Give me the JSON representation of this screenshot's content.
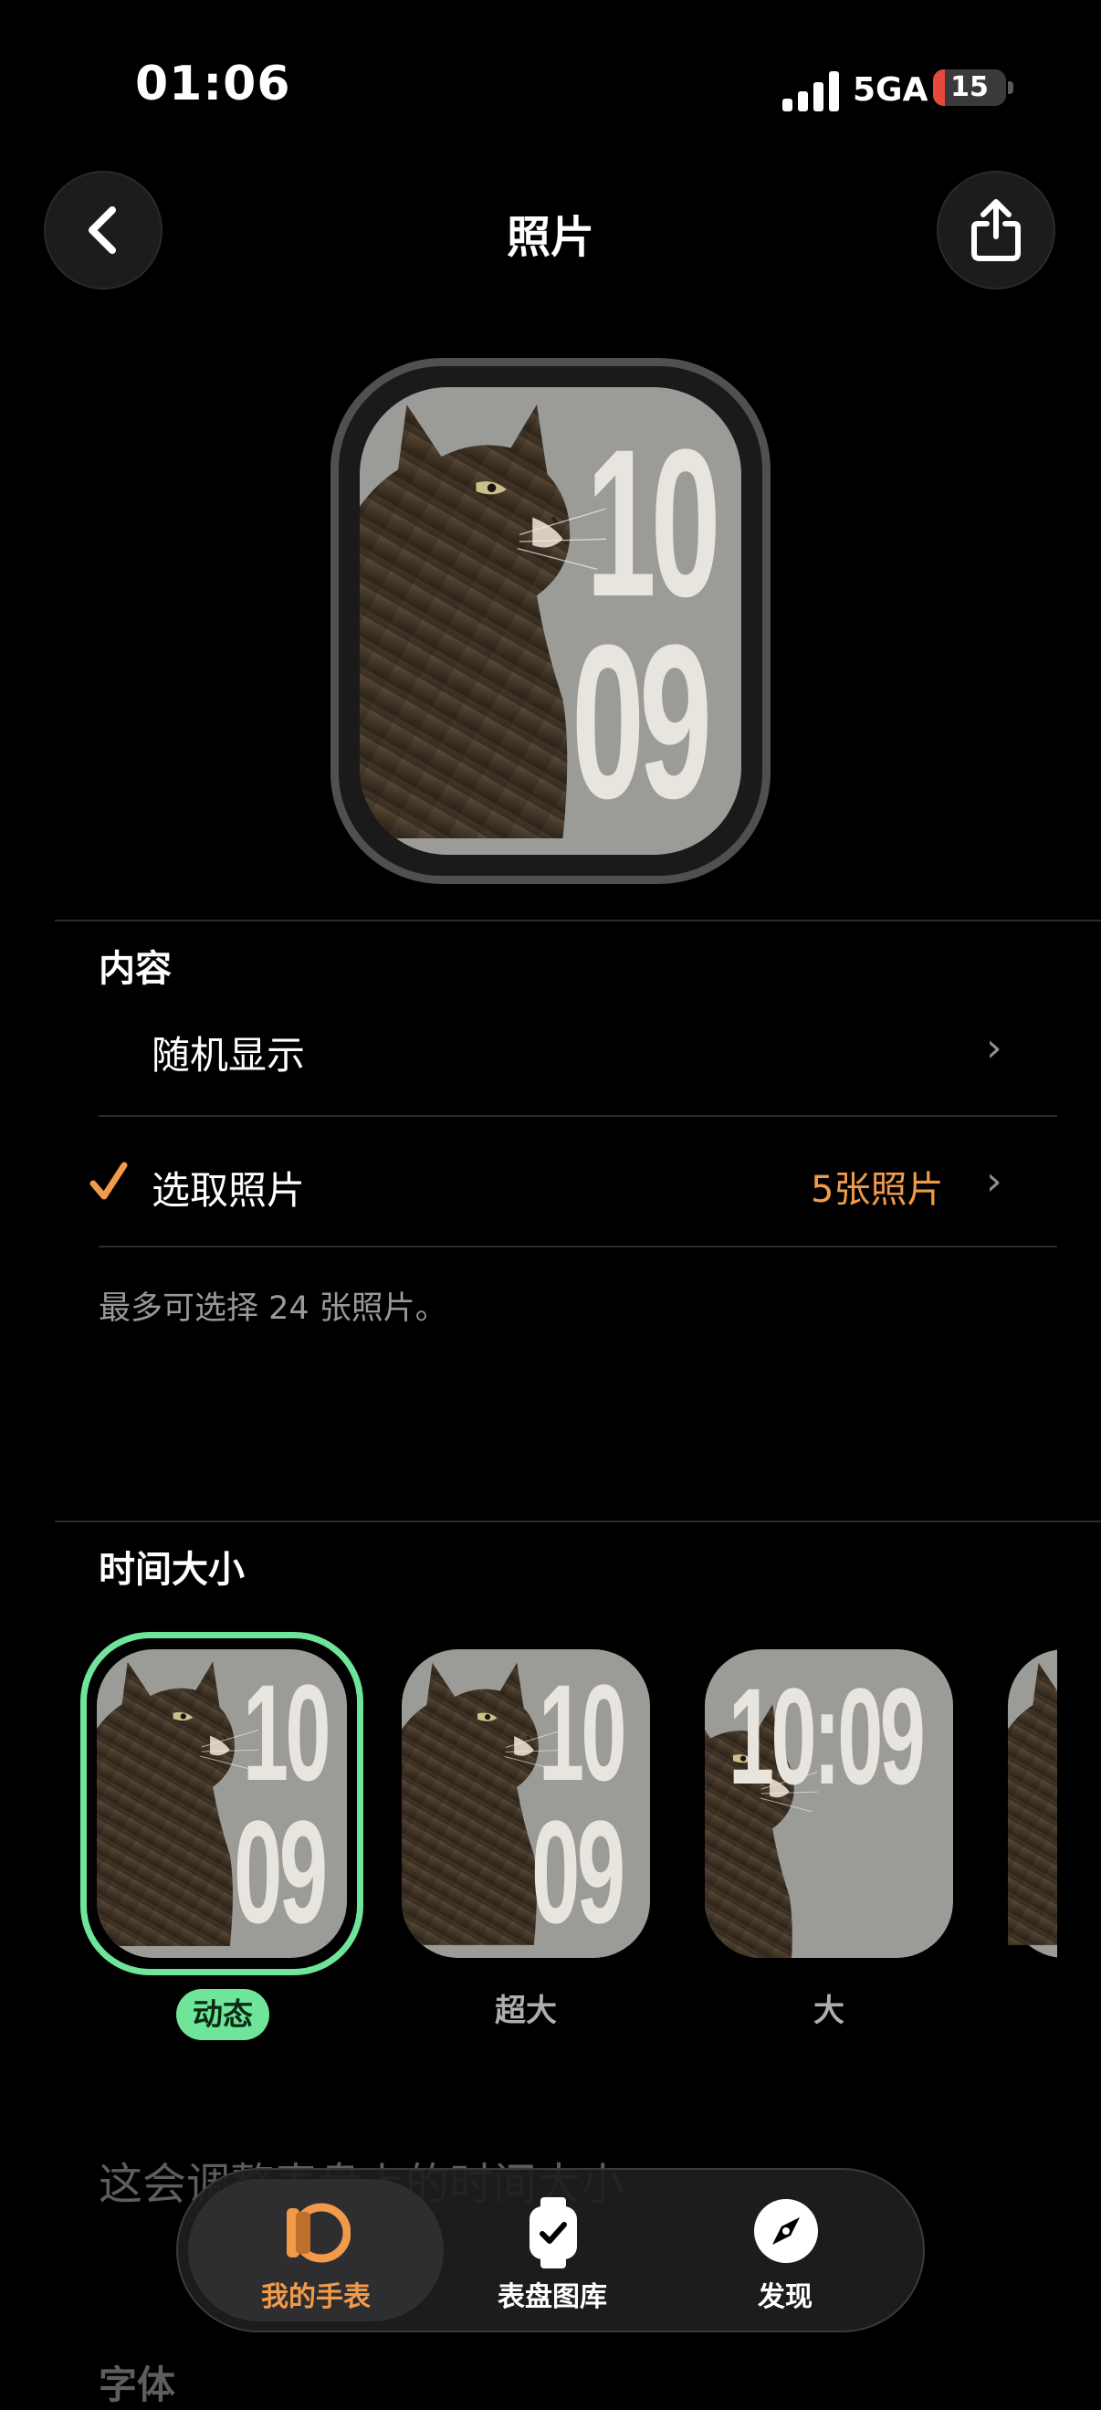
{
  "status_bar": {
    "time": "01:06",
    "network": "5GA",
    "battery": "15"
  },
  "nav": {
    "title": "照片"
  },
  "preview": {
    "hour": "10",
    "minute": "09"
  },
  "content_section": {
    "header": "内容",
    "options": [
      {
        "label": "随机显示",
        "selected": false,
        "value": ""
      },
      {
        "label": "选取照片",
        "selected": true,
        "value": "5张照片"
      }
    ],
    "footnote": "最多可选择 24 张照片。"
  },
  "time_size_section": {
    "header": "时间大小",
    "options": [
      {
        "label": "动态",
        "selected": true,
        "hour": "10",
        "minute": "09"
      },
      {
        "label": "超大",
        "selected": false,
        "hour": "10",
        "minute": "09"
      },
      {
        "label": "大",
        "selected": false,
        "time": "10:09"
      }
    ],
    "description": "这会调整表盘上的时间大小"
  },
  "font_section": {
    "header": "字体"
  },
  "tab_bar": {
    "items": [
      {
        "label": "我的手表",
        "active": true,
        "icon": "watch-ring-icon"
      },
      {
        "label": "表盘图库",
        "active": false,
        "icon": "watch-face-gallery-icon"
      },
      {
        "label": "发现",
        "active": false,
        "icon": "compass-icon"
      }
    ]
  },
  "colors": {
    "accent": "#f19a4a",
    "selected_green": "#6fe59a",
    "background": "#000000"
  }
}
